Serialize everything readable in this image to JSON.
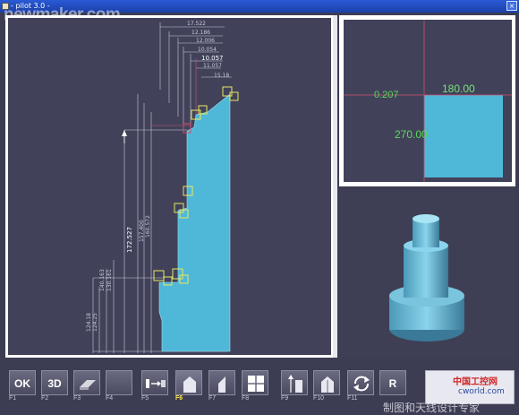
{
  "window": {
    "title": "- pilot 3.0 -",
    "close_label": "×",
    "watermark": "newmaker.com"
  },
  "drawing": {
    "dimensions_top": [
      "17.522",
      "12.186",
      "12.006",
      "10.054",
      "10.057",
      "11.057",
      "15.18"
    ],
    "dimension_vertical_main": "172.527",
    "dimensions_vertical": [
      "157.400",
      "160.572",
      "140.163",
      "130.161",
      "124.18",
      "124.25",
      "93.5",
      "93.8"
    ]
  },
  "section_view": {
    "angle_top": "180.00",
    "offset": "0.207",
    "angle_bottom": "270.00"
  },
  "toolbar": {
    "keys": [
      {
        "label": "F1",
        "glyph": "OK"
      },
      {
        "label": "F2",
        "glyph": "3D"
      },
      {
        "label": "F3",
        "glyph": ""
      },
      {
        "label": "F4",
        "glyph": ""
      },
      {
        "label": "F5",
        "glyph": ""
      },
      {
        "label": "F6",
        "glyph": ""
      },
      {
        "label": "F7",
        "glyph": ""
      },
      {
        "label": "F8",
        "glyph": ""
      },
      {
        "label": "F9",
        "glyph": ""
      },
      {
        "label": "F10",
        "glyph": ""
      },
      {
        "label": "F11",
        "glyph": ""
      },
      {
        "label": "F12",
        "glyph": "R"
      }
    ],
    "active_key": "F6"
  },
  "watermarks": {
    "site": "cworld.com",
    "brand": "中国工控网",
    "bottom_text": "制图和天线设计专家"
  },
  "colors": {
    "part": "#4fb8d8",
    "background": "#41425a",
    "highlight": "#e8e860",
    "accent_line": "#d05070"
  }
}
